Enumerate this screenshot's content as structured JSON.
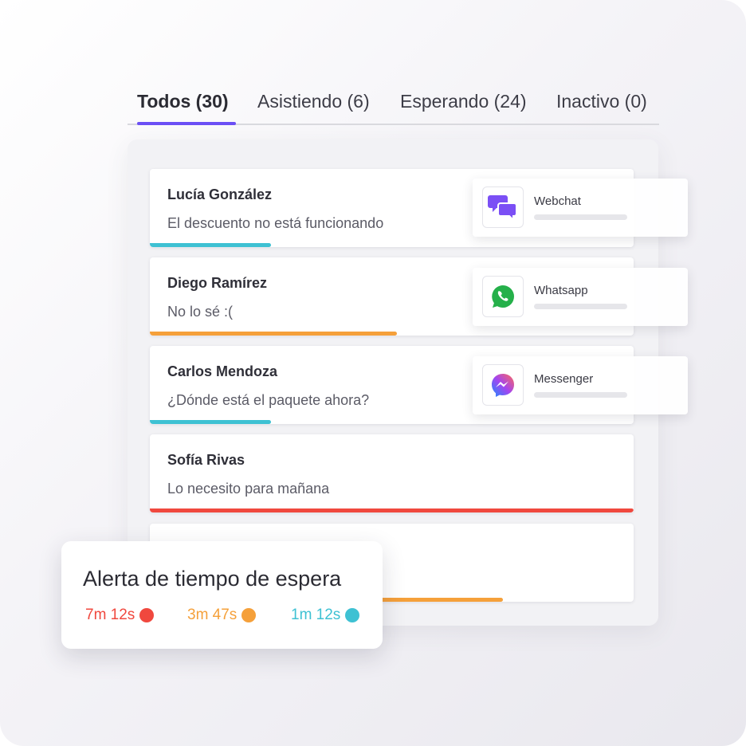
{
  "tabs": [
    {
      "label": "Todos (30)",
      "active": true
    },
    {
      "label": "Asistiendo (6)",
      "active": false
    },
    {
      "label": "Esperando (24)",
      "active": false
    },
    {
      "label": "Inactivo (0)",
      "active": false
    }
  ],
  "conversations": [
    {
      "name": "Lucía González",
      "message": "El descuento no está funcionando",
      "bar_color": "#3ec1d3",
      "bar_fraction": 0.25
    },
    {
      "name": "Diego Ramírez",
      "message": "No lo sé :(",
      "bar_color": "#f5a03a",
      "bar_fraction": 0.51
    },
    {
      "name": "Carlos Mendoza",
      "message": "¿Dónde está el paquete ahora?",
      "bar_color": "#3ec1d3",
      "bar_fraction": 0.25
    },
    {
      "name": "Sofía Rivas",
      "message": "Lo necesito para mañana",
      "bar_color": "#f0483e",
      "bar_fraction": 1.0
    },
    {
      "name": "",
      "message": "",
      "bar_color": "#f5a03a",
      "bar_fraction": 0.73
    }
  ],
  "channels": [
    {
      "label": "Webchat",
      "icon": "webchat-icon",
      "color": "#7b4ff5"
    },
    {
      "label": "Whatsapp",
      "icon": "whatsapp-icon",
      "color": "#25b04a"
    },
    {
      "label": "Messenger",
      "icon": "messenger-icon",
      "color": "#a445f0"
    }
  ],
  "alert": {
    "title": "Alerta de tiempo de espera",
    "items": [
      {
        "time": "7m 12s",
        "color": "#f0483e"
      },
      {
        "time": "3m 47s",
        "color": "#f5a03a"
      },
      {
        "time": "1m 12s",
        "color": "#3ec1d3"
      }
    ]
  },
  "colors": {
    "accent": "#6b4ff5"
  }
}
